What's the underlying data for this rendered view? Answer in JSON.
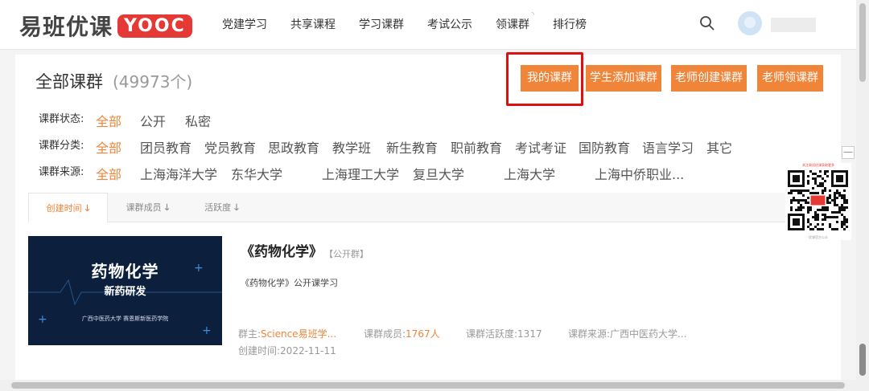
{
  "header": {
    "logo_text": "易班优课",
    "logo_badge": "YOOC",
    "nav": [
      "党建学习",
      "共享课程",
      "学习课群",
      "考试公示",
      "领课群",
      "排行榜"
    ]
  },
  "page": {
    "title": "全部课群",
    "count": "(49973个)"
  },
  "buttons": {
    "mine": "我的课群",
    "student_add": "学生添加课群",
    "teacher_create": "老师创建课群",
    "teacher_claim": "老师领课群"
  },
  "filters": {
    "status": {
      "label": "课群状态:",
      "options": [
        "全部",
        "公开",
        "私密"
      ]
    },
    "category": {
      "label": "课群分类:",
      "options": [
        "全部",
        "团员教育",
        "党员教育",
        "思政教育",
        "教学班",
        "新生教育",
        "职前教育",
        "考试考证",
        "国防教育",
        "语言学习",
        "其它"
      ]
    },
    "source": {
      "label": "课群来源:",
      "options": [
        "全部",
        "上海海洋大学",
        "东华大学",
        "上海理工大学",
        "复旦大学",
        "上海大学",
        "上海中侨职业..."
      ]
    }
  },
  "sort": {
    "tabs": [
      "创建时间",
      "课群成员",
      "活跃度"
    ]
  },
  "course": {
    "thumb_title": "药物化学",
    "thumb_sub": "新药研发",
    "thumb_foot": "广西中医药大学   赛恩斯新医药学院",
    "name": "《药物化学》",
    "tag": "【公开群】",
    "desc": "《药物化学》公开课学习",
    "owner_label": "群主:",
    "owner": "Science易班学...",
    "members_label": "课群成员:",
    "members": "1767人",
    "activity": "课群活跃度:1317",
    "source": "课群来源:广西中医药大学...",
    "created": "创建时间:2022-11-11"
  },
  "qr": {
    "caption": "关注易班优课获取更多",
    "foot": "优课官方公众"
  },
  "colors": {
    "accent": "#f0853a",
    "highlight_box": "#e01010",
    "logo_badge": "#e53935"
  }
}
